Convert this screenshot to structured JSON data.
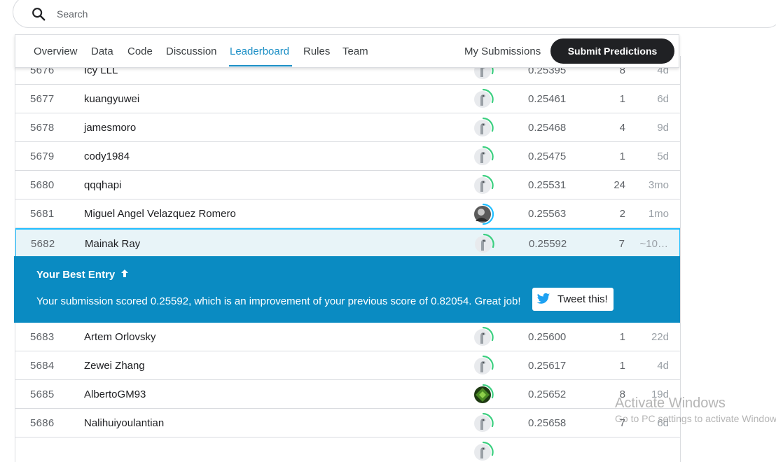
{
  "search": {
    "placeholder": "Search",
    "icon": "search-icon"
  },
  "tabs": [
    {
      "label": "Overview"
    },
    {
      "label": "Data"
    },
    {
      "label": "Code"
    },
    {
      "label": "Discussion"
    },
    {
      "label": "Leaderboard"
    },
    {
      "label": "Rules"
    },
    {
      "label": "Team"
    }
  ],
  "active_tab": "Leaderboard",
  "my_submissions_label": "My Submissions",
  "submit_label": "Submit Predictions",
  "rows": [
    {
      "rank": "5676",
      "team": "Icy LLL",
      "score": "0.25395",
      "entries": "8",
      "last": "4d",
      "avatar": "default-goose"
    },
    {
      "rank": "5677",
      "team": "kuangyuwei",
      "score": "0.25461",
      "entries": "1",
      "last": "6d",
      "avatar": "default-goose"
    },
    {
      "rank": "5678",
      "team": "jamesmoro",
      "score": "0.25468",
      "entries": "4",
      "last": "9d",
      "avatar": "default-goose"
    },
    {
      "rank": "5679",
      "team": "cody1984",
      "score": "0.25475",
      "entries": "1",
      "last": "5d",
      "avatar": "default-goose"
    },
    {
      "rank": "5680",
      "team": "qqqhapi",
      "score": "0.25531",
      "entries": "24",
      "last": "3mo",
      "avatar": "default-goose"
    },
    {
      "rank": "5681",
      "team": "Miguel Angel Velazquez Romero",
      "score": "0.25563",
      "entries": "2",
      "last": "1mo",
      "avatar": "photo"
    },
    {
      "rank": "5682",
      "team": "Mainak Ray",
      "score": "0.25592",
      "entries": "7",
      "last": "~10…",
      "avatar": "default-goose"
    }
  ],
  "best_entry": {
    "title": "Your Best Entry",
    "message": "Your submission scored 0.25592, which is an improvement of your previous score of 0.82054. Great job!",
    "tweet_label": "Tweet this!"
  },
  "rows_after": [
    {
      "rank": "5683",
      "team": "Artem Orlovsky",
      "score": "0.25600",
      "entries": "1",
      "last": "22d",
      "avatar": "default-goose"
    },
    {
      "rank": "5684",
      "team": "Zewei Zhang",
      "score": "0.25617",
      "entries": "1",
      "last": "4d",
      "avatar": "default-goose"
    },
    {
      "rank": "5685",
      "team": "AlbertoGM93",
      "score": "0.25652",
      "entries": "8",
      "last": "19d",
      "avatar": "green-diamond"
    },
    {
      "rank": "5686",
      "team": "Nalihuiyoulantian",
      "score": "0.25658",
      "entries": "7",
      "last": "6d",
      "avatar": "default-goose"
    }
  ],
  "watermark": {
    "line1": "Activate Windows",
    "line2": "Go to PC settings to activate Windows."
  },
  "colors": {
    "accent": "#1a8ec5",
    "banner": "#0a8bc2",
    "highlight_border": "#20beff",
    "highlight_bg": "#e8f4f8",
    "tier_ring": "#3ccf80"
  }
}
